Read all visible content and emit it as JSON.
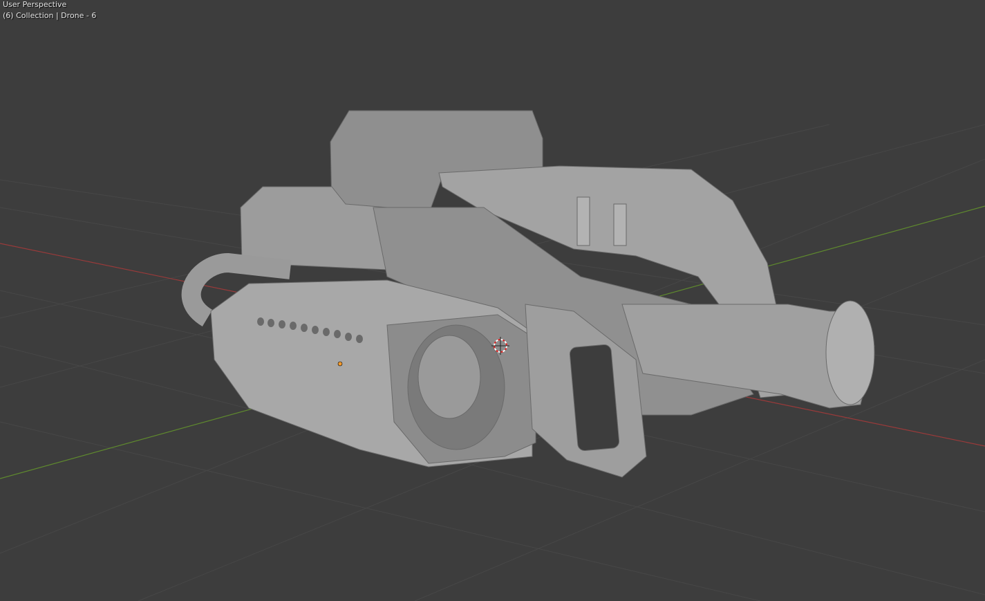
{
  "viewport": {
    "view_name": "User Perspective",
    "object_info": "(6) Collection | Drone - 6"
  },
  "colors": {
    "background": "#3d3d3d",
    "grid": "#4a4a4a",
    "x_axis": "#9a3a3a",
    "y_axis": "#5f8a2e",
    "model": "#a6a6a6",
    "origin": "#f29a2e"
  }
}
